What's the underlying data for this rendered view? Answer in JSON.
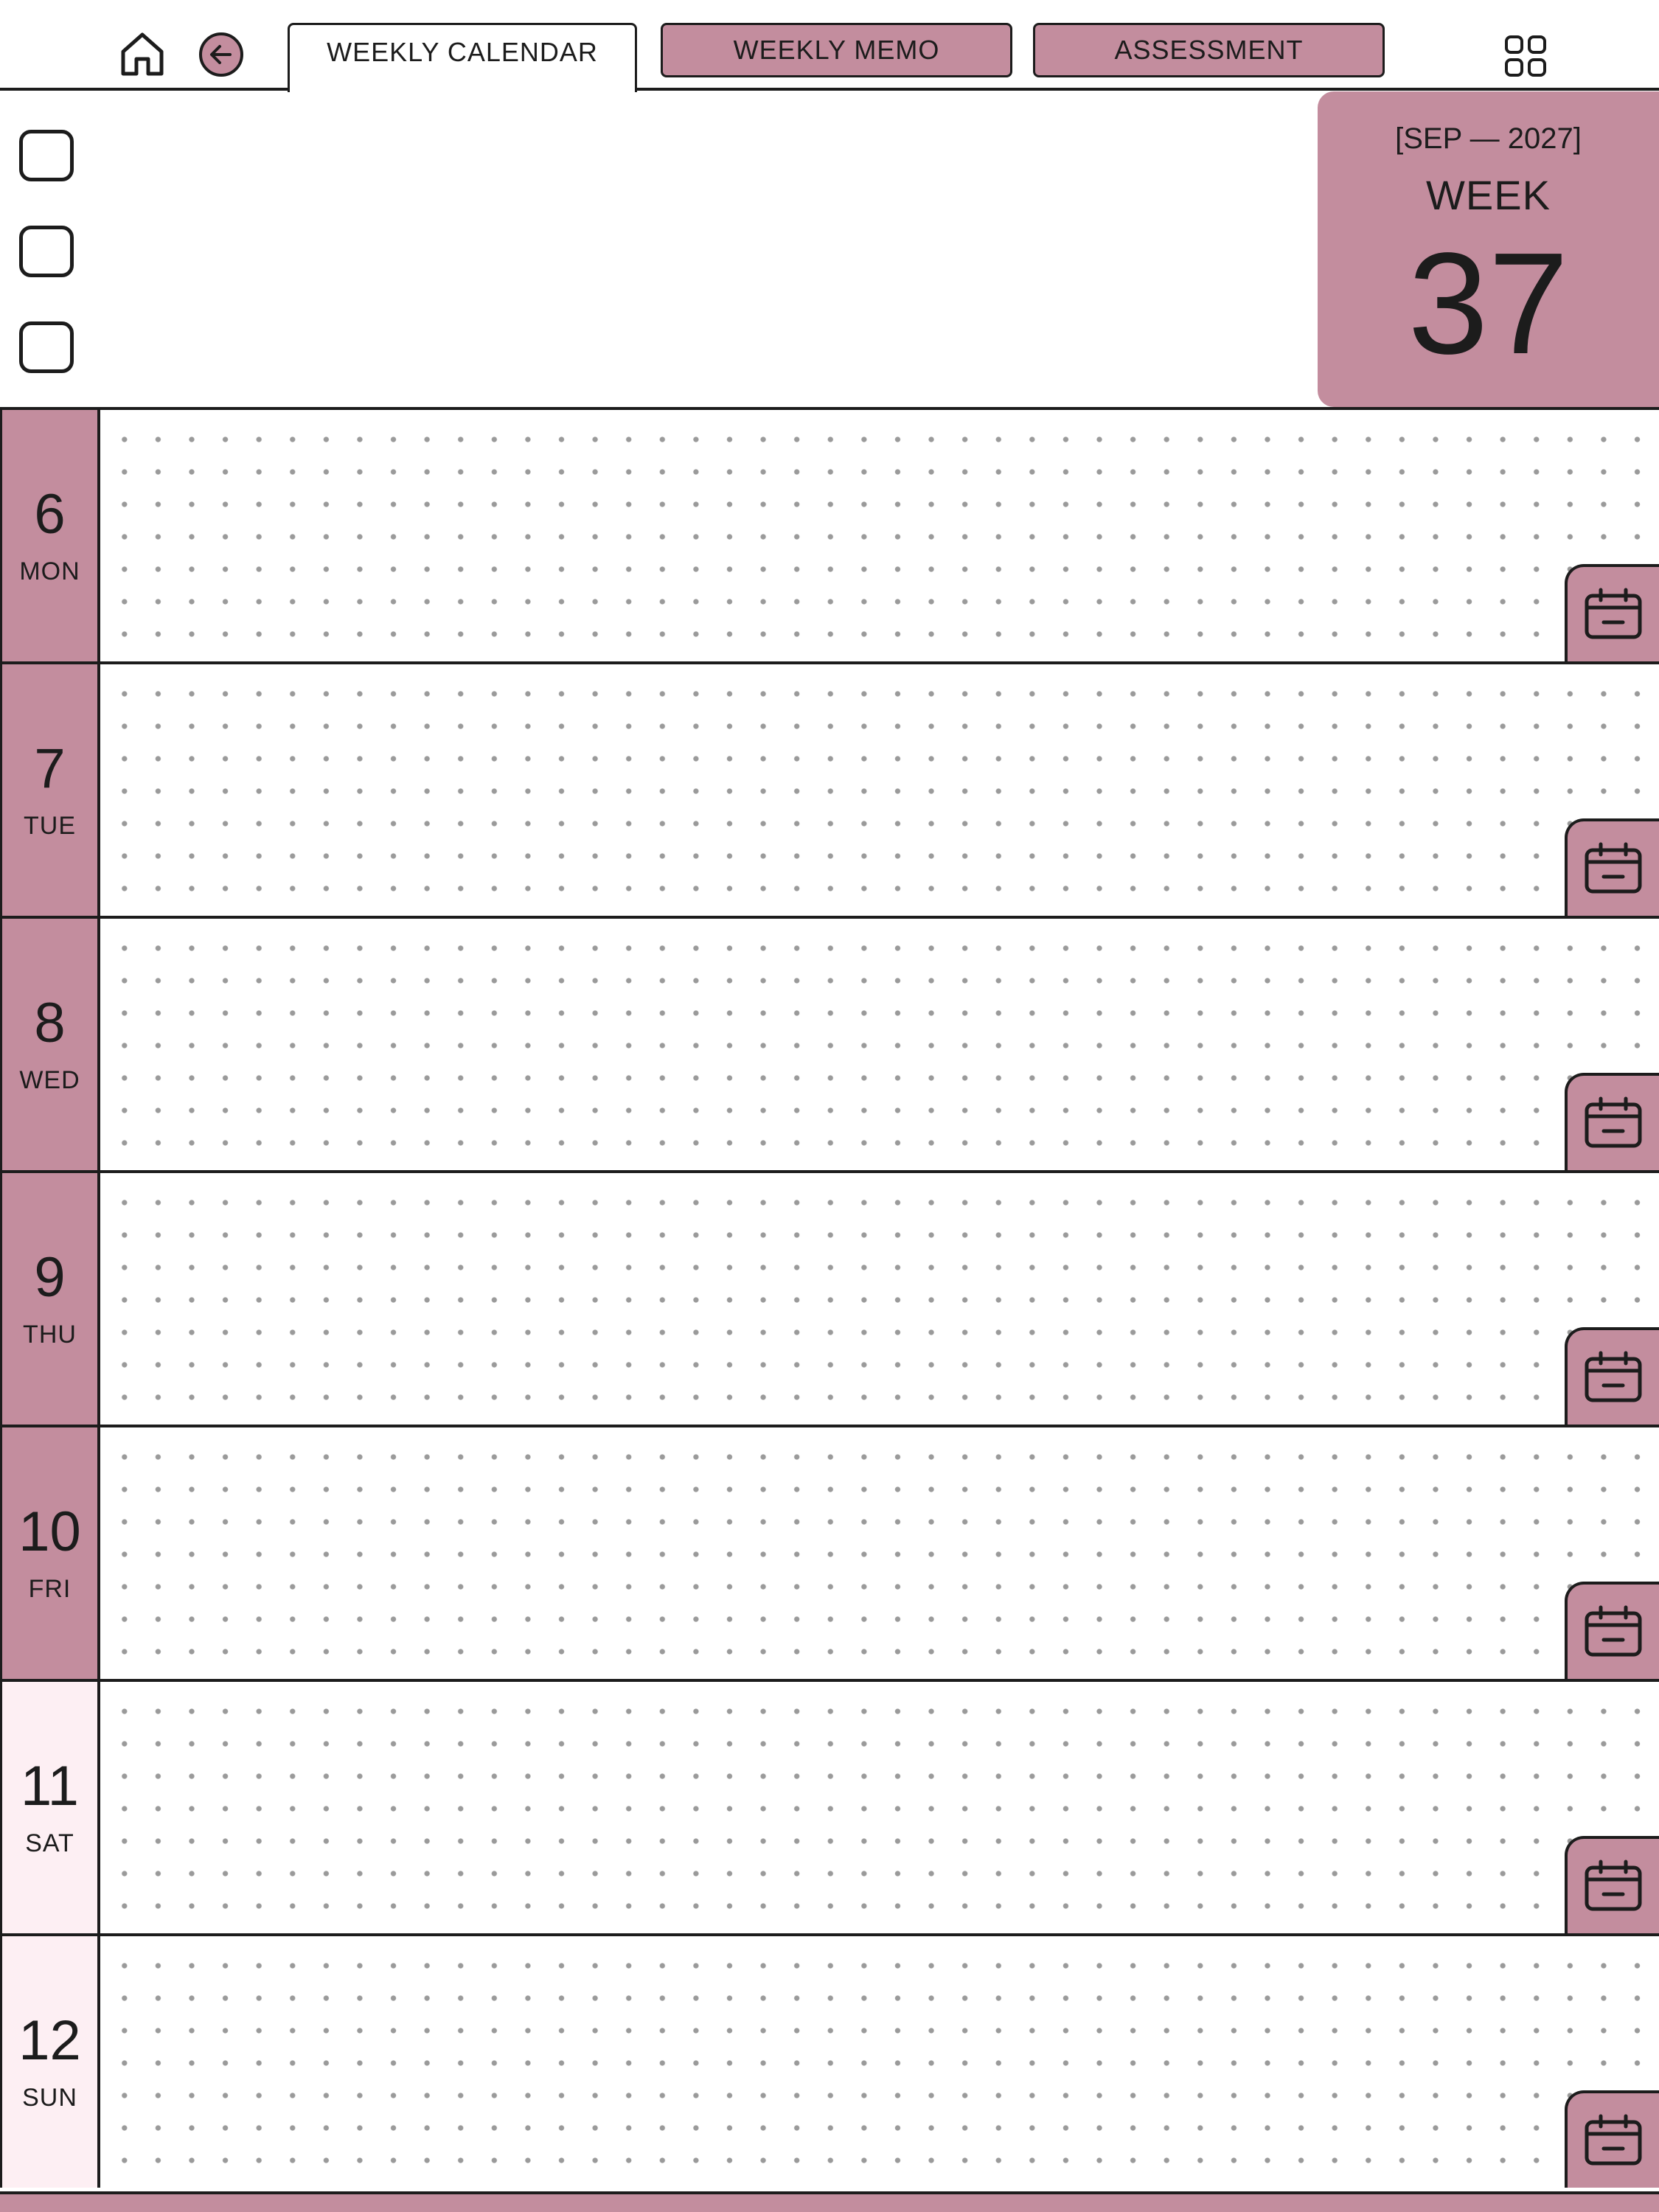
{
  "nav": {
    "tabs": [
      {
        "label": "WEEKLY CALENDAR",
        "active": true
      },
      {
        "label": "WEEKLY MEMO",
        "active": false
      },
      {
        "label": "ASSESSMENT",
        "active": false
      }
    ],
    "icons": {
      "home": "home-icon",
      "back": "arrow-left-icon",
      "menu": "grid-icon"
    }
  },
  "header": {
    "range": "[SEP — 2027]",
    "week_label": "WEEK",
    "week_number": "37",
    "checkbox_count": 3
  },
  "days": [
    {
      "num": "6",
      "name": "MON",
      "weekend": false
    },
    {
      "num": "7",
      "name": "TUE",
      "weekend": false
    },
    {
      "num": "8",
      "name": "WED",
      "weekend": false
    },
    {
      "num": "9",
      "name": "THU",
      "weekend": false
    },
    {
      "num": "10",
      "name": "FRI",
      "weekend": false
    },
    {
      "num": "11",
      "name": "SAT",
      "weekend": true
    },
    {
      "num": "12",
      "name": "SUN",
      "weekend": true
    }
  ],
  "colors": {
    "accent": "#c38d9e",
    "weekend": "#fdeff3",
    "ink": "#1c1c1c",
    "dot": "#9a9a9a"
  }
}
